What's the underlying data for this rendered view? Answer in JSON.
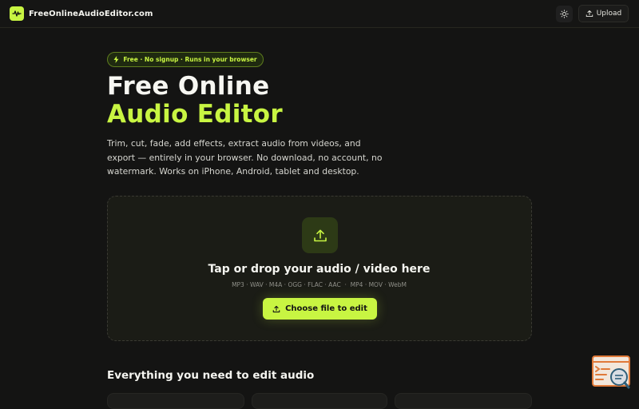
{
  "header": {
    "brand_name": "FreeOnlineAudioEditor.com",
    "upload_label": "Upload",
    "icons": {
      "logo": "waveform-icon",
      "theme": "sun-icon",
      "upload": "upload-icon"
    }
  },
  "hero": {
    "pill_text": "Free · No signup · Runs in your browser",
    "title_line1": "Free Online",
    "title_line2": "Audio Editor",
    "description": "Trim, cut, fade, add effects, extract audio from videos, and export — entirely in your browser. No download, no account, no watermark. Works on iPhone, Android, tablet and desktop."
  },
  "dropzone": {
    "title": "Tap or drop your audio / video here",
    "formats": "MP3 · WAV · M4A · OGG · FLAC · AAC  ·  MP4 · MOV · WebM",
    "button_label": "Choose file to edit"
  },
  "features": {
    "section_title": "Everything you need to edit audio"
  },
  "colors": {
    "accent": "#c8f542",
    "background": "#141413",
    "surface": "#1b1c16"
  }
}
